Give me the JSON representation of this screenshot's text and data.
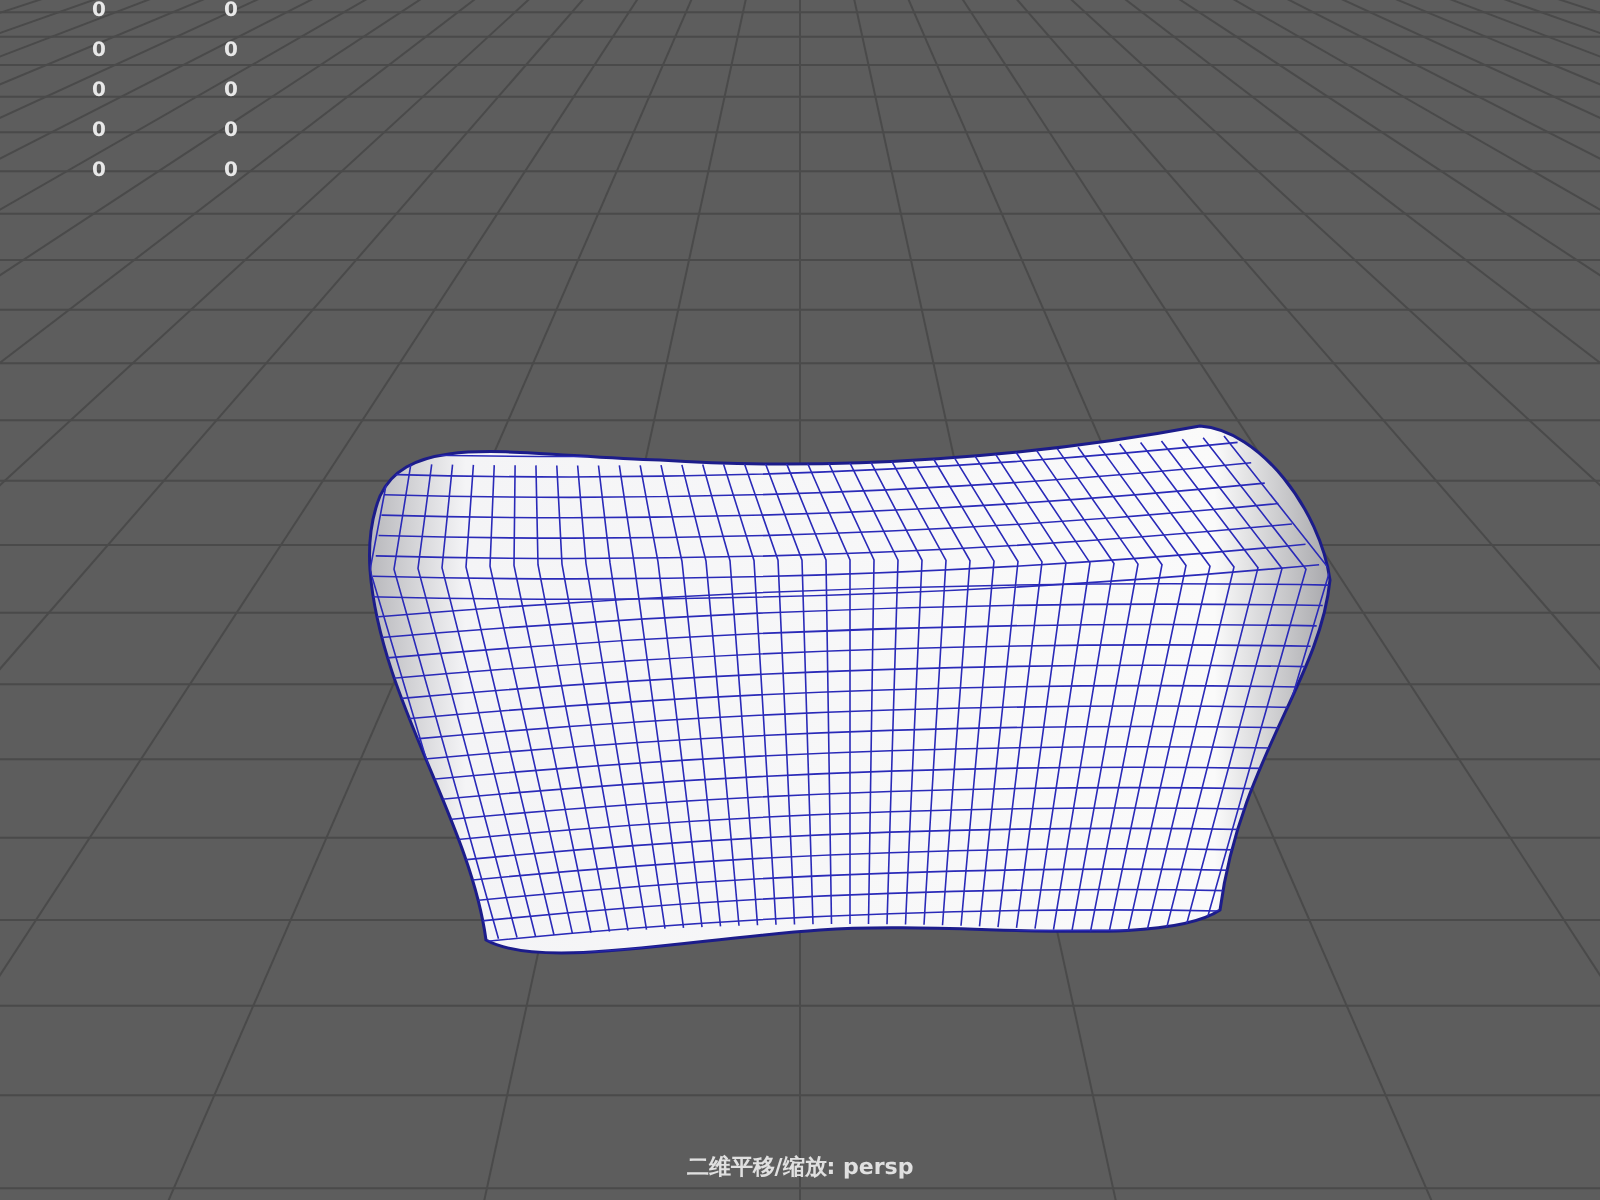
{
  "hud_rows": [
    {
      "column_1": "0",
      "column_2": "0"
    },
    {
      "column_1": "0",
      "column_2": "0"
    },
    {
      "column_1": "0",
      "column_2": "0"
    },
    {
      "column_1": "0",
      "column_2": "0"
    },
    {
      "column_1": "0",
      "column_2": "0"
    }
  ],
  "status_caption": "二维平移/缩放: persp"
}
